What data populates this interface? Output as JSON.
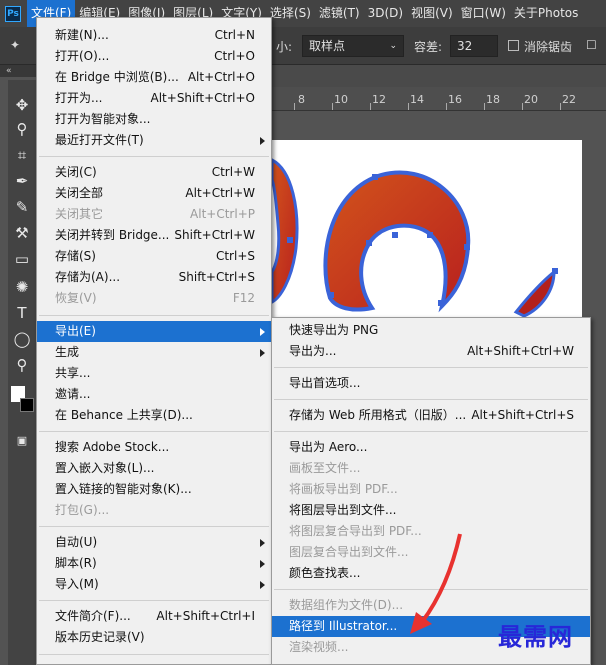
{
  "app": {
    "logo": "Ps"
  },
  "menubar": {
    "items": [
      "文件(F)",
      "编辑(E)",
      "图像(I)",
      "图层(L)",
      "文字(Y)",
      "选择(S)",
      "滤镜(T)",
      "3D(D)",
      "视图(V)",
      "窗口(W)",
      "关于Photos"
    ]
  },
  "options": {
    "size_label": "小:",
    "sample_select": "取样点",
    "tolerance_label": "容差:",
    "tolerance_value": "32",
    "antialias_label": "消除锯齿"
  },
  "toolbar": {
    "collapse_glyph": "«",
    "tools": [
      "move-tool-icon",
      "lasso-tool-icon",
      "crop-tool-icon",
      "eyedropper-tool-icon",
      "brush-tool-icon",
      "history-brush-tool-icon",
      "gradient-tool-icon",
      "dodge-tool-icon",
      "type-tool-icon",
      "ellipse-tool-icon",
      "zoom-tool-icon"
    ],
    "glyphs": [
      "✥",
      "⚲",
      "⌗",
      "✒",
      "✎",
      "⚒",
      "▭",
      "✺",
      "T",
      "◯",
      "⚲"
    ]
  },
  "ruler": {
    "labels": [
      "8",
      "10",
      "12",
      "14",
      "16",
      "18",
      "20",
      "22"
    ]
  },
  "file_menu": {
    "items": [
      {
        "label": "新建(N)...",
        "shortcut": "Ctrl+N",
        "state": "normal"
      },
      {
        "label": "打开(O)...",
        "shortcut": "Ctrl+O",
        "state": "normal"
      },
      {
        "label": "在 Bridge 中浏览(B)...",
        "shortcut": "Alt+Ctrl+O",
        "state": "normal"
      },
      {
        "label": "打开为...",
        "shortcut": "Alt+Shift+Ctrl+O",
        "state": "normal"
      },
      {
        "label": "打开为智能对象...",
        "shortcut": "",
        "state": "normal"
      },
      {
        "label": "最近打开文件(T)",
        "shortcut": "",
        "state": "normal",
        "submenu": true
      },
      {
        "label": "关闭(C)",
        "shortcut": "Ctrl+W",
        "state": "normal"
      },
      {
        "label": "关闭全部",
        "shortcut": "Alt+Ctrl+W",
        "state": "normal"
      },
      {
        "label": "关闭其它",
        "shortcut": "Alt+Ctrl+P",
        "state": "disabled"
      },
      {
        "label": "关闭并转到 Bridge...",
        "shortcut": "Shift+Ctrl+W",
        "state": "normal"
      },
      {
        "label": "存储(S)",
        "shortcut": "Ctrl+S",
        "state": "normal"
      },
      {
        "label": "存储为(A)...",
        "shortcut": "Shift+Ctrl+S",
        "state": "normal"
      },
      {
        "label": "恢复(V)",
        "shortcut": "F12",
        "state": "disabled"
      },
      {
        "label": "导出(E)",
        "shortcut": "",
        "state": "highlight",
        "submenu": true
      },
      {
        "label": "生成",
        "shortcut": "",
        "state": "normal",
        "submenu": true
      },
      {
        "label": "共享...",
        "shortcut": "",
        "state": "normal"
      },
      {
        "label": "邀请...",
        "shortcut": "",
        "state": "normal"
      },
      {
        "label": "在 Behance 上共享(D)...",
        "shortcut": "",
        "state": "normal"
      },
      {
        "label": "搜索 Adobe Stock...",
        "shortcut": "",
        "state": "normal"
      },
      {
        "label": "置入嵌入对象(L)...",
        "shortcut": "",
        "state": "normal"
      },
      {
        "label": "置入链接的智能对象(K)...",
        "shortcut": "",
        "state": "normal"
      },
      {
        "label": "打包(G)...",
        "shortcut": "",
        "state": "disabled"
      },
      {
        "label": "自动(U)",
        "shortcut": "",
        "state": "normal",
        "submenu": true
      },
      {
        "label": "脚本(R)",
        "shortcut": "",
        "state": "normal",
        "submenu": true
      },
      {
        "label": "导入(M)",
        "shortcut": "",
        "state": "normal",
        "submenu": true
      },
      {
        "label": "文件简介(F)...",
        "shortcut": "Alt+Shift+Ctrl+I",
        "state": "normal"
      },
      {
        "label": "版本历史记录(V)",
        "shortcut": "",
        "state": "normal"
      }
    ]
  },
  "export_menu": {
    "items": [
      {
        "label": "快速导出为 PNG",
        "shortcut": "",
        "state": "normal"
      },
      {
        "label": "导出为...",
        "shortcut": "Alt+Shift+Ctrl+W",
        "state": "normal"
      },
      {
        "label": "导出首选项...",
        "shortcut": "",
        "state": "normal"
      },
      {
        "label": "存储为 Web 所用格式（旧版）...",
        "shortcut": "Alt+Shift+Ctrl+S",
        "state": "normal"
      },
      {
        "label": "导出为 Aero...",
        "shortcut": "",
        "state": "normal"
      },
      {
        "label": "画板至文件...",
        "shortcut": "",
        "state": "disabled"
      },
      {
        "label": "将画板导出到 PDF...",
        "shortcut": "",
        "state": "disabled"
      },
      {
        "label": "将图层导出到文件...",
        "shortcut": "",
        "state": "normal"
      },
      {
        "label": "将图层复合导出到 PDF...",
        "shortcut": "",
        "state": "disabled"
      },
      {
        "label": "图层复合导出到文件...",
        "shortcut": "",
        "state": "disabled"
      },
      {
        "label": "颜色查找表...",
        "shortcut": "",
        "state": "normal"
      },
      {
        "label": "数据组作为文件(D)...",
        "shortcut": "",
        "state": "disabled"
      },
      {
        "label": "路径到 Illustrator...",
        "shortcut": "",
        "state": "highlight"
      },
      {
        "label": "渲染视频...",
        "shortcut": "",
        "state": "disabled"
      }
    ]
  },
  "watermark": {
    "text": "最需网"
  },
  "colors": {
    "accent": "#1c71d0",
    "arrow": "#e8322f",
    "path": "#3a63d8",
    "shape": "#c7401a"
  }
}
